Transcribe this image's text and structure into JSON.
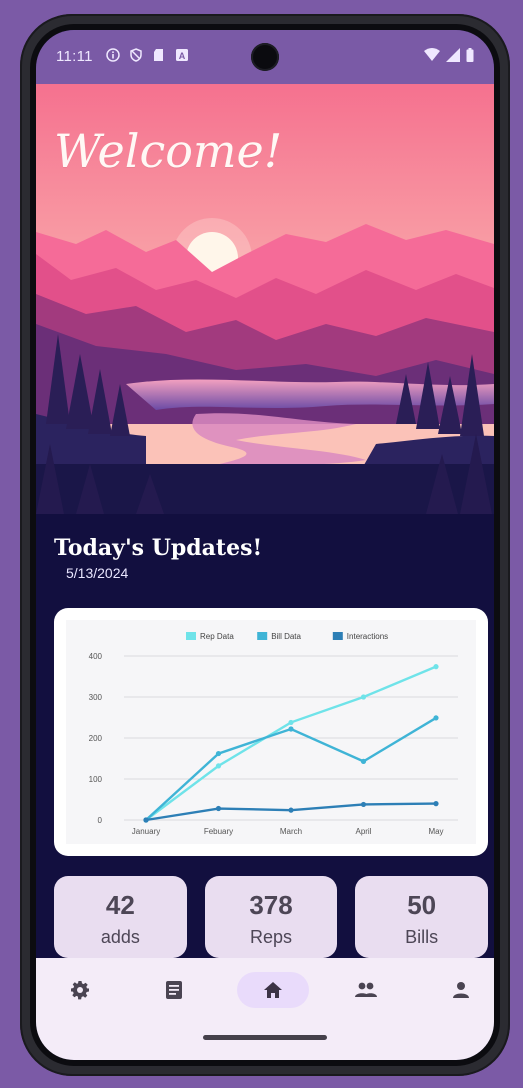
{
  "status_bar": {
    "time": "11:11",
    "icons_left": [
      "info-icon",
      "shield-icon",
      "sd-card-icon",
      "a-icon"
    ],
    "icons_right": [
      "wifi-icon",
      "signal-icon",
      "battery-icon"
    ]
  },
  "hero": {
    "welcome_text": "Welcome!"
  },
  "updates": {
    "title": "Today's Updates!",
    "date": "5/13/2024"
  },
  "chart_data": {
    "type": "line",
    "categories": [
      "January",
      "Febuary",
      "March",
      "April",
      "May"
    ],
    "series": [
      {
        "name": "Rep Data",
        "values": [
          0,
          132,
          238,
          300,
          374
        ],
        "color": "#6fe3e9"
      },
      {
        "name": "Bill Data",
        "values": [
          0,
          162,
          222,
          143,
          249
        ],
        "color": "#3fb4d6"
      },
      {
        "name": "Interactions",
        "values": [
          0,
          28,
          24,
          38,
          40
        ],
        "color": "#2d7fb6"
      }
    ],
    "y_ticks": [
      0,
      100,
      200,
      300,
      400
    ],
    "ylim": [
      0,
      400
    ],
    "legend_position": "top",
    "grid": true
  },
  "stats": [
    {
      "value": "42",
      "label": "adds"
    },
    {
      "value": "378",
      "label": "Reps"
    },
    {
      "value": "50",
      "label": "Bills"
    }
  ],
  "nav": {
    "items": [
      "gear-icon",
      "document-icon",
      "home-icon",
      "people-icon",
      "person-icon"
    ],
    "active": "home-icon"
  },
  "colors": {
    "status_bar": "#7a5aa6",
    "background": "#120f3f",
    "card": "#e9ddf0",
    "nav": "#f4ecf8"
  }
}
